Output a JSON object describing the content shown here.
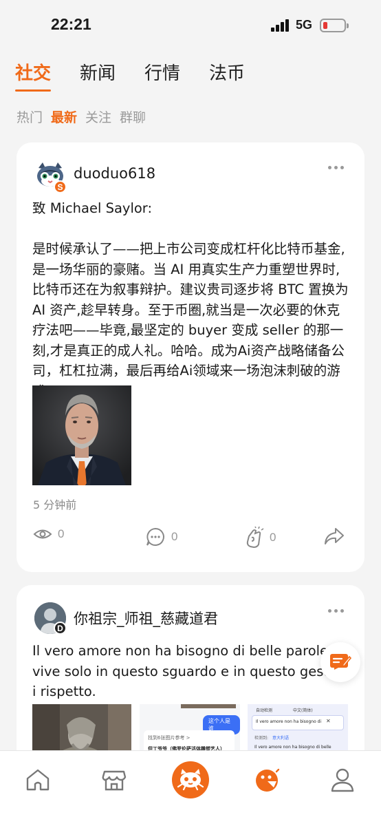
{
  "status_bar": {
    "time": "22:21",
    "network": "5G"
  },
  "main_tabs": [
    {
      "label": "社交",
      "active": true
    },
    {
      "label": "新闻",
      "active": false
    },
    {
      "label": "行情",
      "active": false
    },
    {
      "label": "法币",
      "active": false
    }
  ],
  "sub_tabs": [
    {
      "label": "热门",
      "active": false
    },
    {
      "label": "最新",
      "active": true
    },
    {
      "label": "关注",
      "active": false
    },
    {
      "label": "群聊",
      "active": false
    }
  ],
  "posts": [
    {
      "username": "duoduo618",
      "badge": "S",
      "content": "致 Michael Saylor:\n\n是时候承认了——把上市公司变成杠杆化比特币基金,是一场华丽的豪赌。当 AI 用真实生产力重塑世界时,比特币还在为叙事辩护。建议贵司逐步将 BTC 置换为 AI 资产,趁早转身。至于币圈,就当是一次必要的休克疗法吧——毕竟,最坚定的 buyer 变成 seller 的那一刻,才是真正的成人礼。哈哈。成为Ai资产战略储备公司，杠杠拉满，最后再给Ai领域来一场泡沫刺破的游戏。",
      "timestamp": "5 分钟前",
      "views": "0",
      "comments": "0",
      "likes": "0"
    },
    {
      "username": "你祖宗_师祖_慈藏道君",
      "badge": "D",
      "content": "Il vero amore non ha bisogno di belle parole... vive solo in questo sguardo e in questo gesto di rispetto."
    }
  ],
  "thumbnails": {
    "search_pill": "这个人是谁",
    "search_hint": "找到6张图片参考 >",
    "search_result": "但丁爷爷（佛罗伦萨活体雕塑艺人）",
    "translate_source": "自动检测",
    "translate_target": "中文(简体)",
    "translate_input": "Il vero amore non ha bisogno di",
    "translate_detected_label": "检测到:",
    "translate_detected": "意大利语",
    "translate_output": "Il vero amore non ha bisogno di belle parole"
  },
  "colors": {
    "accent": "#f06a19",
    "badge_s": "#f06a19",
    "badge_d": "#222222"
  },
  "icons": {
    "nav": [
      "home-icon",
      "market-icon",
      "social-cat-icon",
      "discover-icon",
      "profile-icon"
    ],
    "fab": "edit-note-icon"
  }
}
